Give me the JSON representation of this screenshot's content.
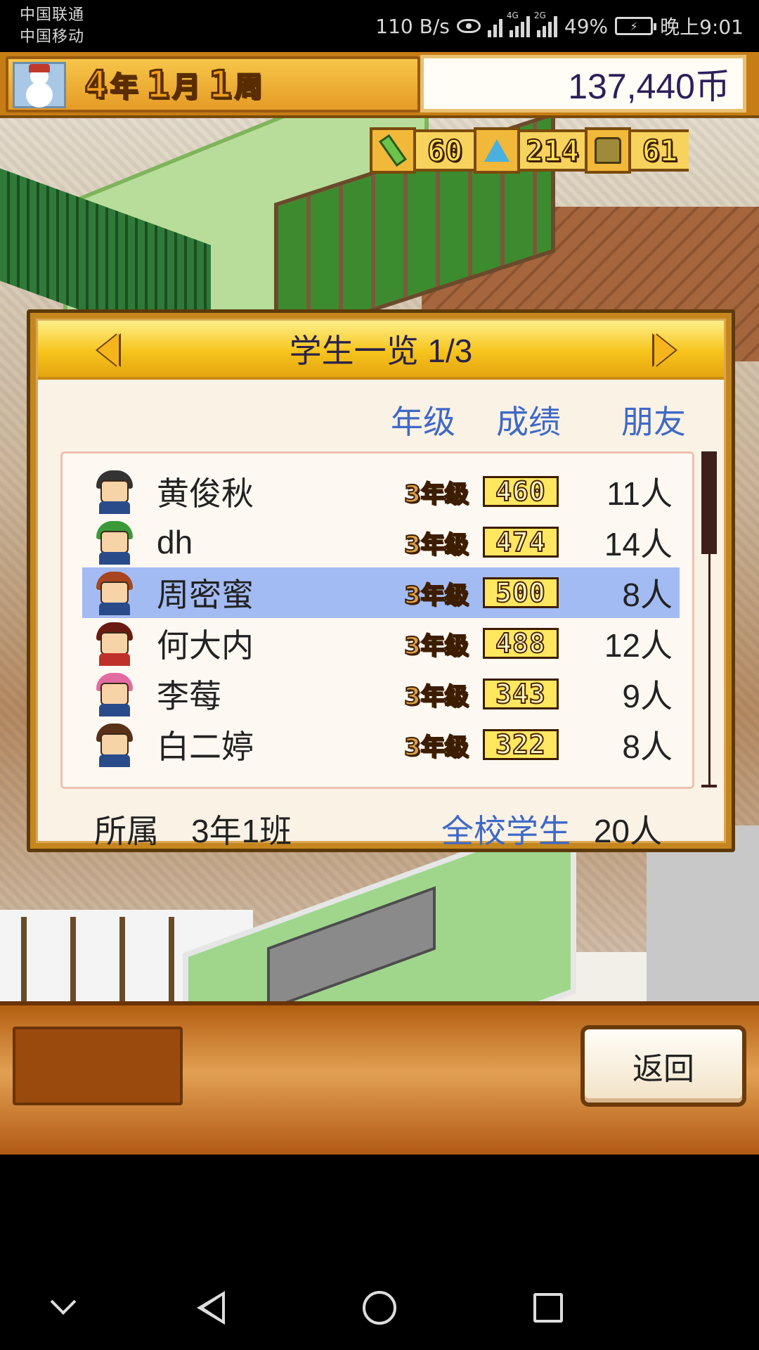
{
  "status_bar": {
    "carrier1": "中国联通",
    "carrier2": "中国移动",
    "net_speed": "110 B/s",
    "signal1_tag": "4G",
    "signal2_tag": "2G",
    "battery": "49%",
    "time": "晚上9:01"
  },
  "header": {
    "date": {
      "year": "4",
      "year_unit": "年",
      "month": "1",
      "month_unit": "月",
      "week": "1",
      "week_unit": "周"
    },
    "money": "137,440币"
  },
  "resources": [
    {
      "icon": "pencil-icon",
      "value": "60"
    },
    {
      "icon": "flask-icon",
      "value": "214"
    },
    {
      "icon": "bell-icon",
      "value": "61"
    }
  ],
  "dialog": {
    "title": "学生一览 1/3",
    "columns": {
      "grade": "年级",
      "score": "成绩",
      "friends": "朋友"
    },
    "students": [
      {
        "name": "黄俊秋",
        "grade": "3年级",
        "score": "460",
        "friends": "11人",
        "hair": "#333333",
        "body": "#2a4b8a"
      },
      {
        "name": "dh",
        "grade": "3年级",
        "score": "474",
        "friends": "14人",
        "hair": "#3a9a3a",
        "body": "#2a4b8a"
      },
      {
        "name": "周密蜜",
        "grade": "3年级",
        "score": "500",
        "friends": "8人",
        "hair": "#a8451e",
        "body": "#2a4b8a",
        "selected": true
      },
      {
        "name": "何大内",
        "grade": "3年级",
        "score": "488",
        "friends": "12人",
        "hair": "#6a1a12",
        "body": "#c0302a"
      },
      {
        "name": "李莓",
        "grade": "3年级",
        "score": "343",
        "friends": "9人",
        "hair": "#e26ca0",
        "body": "#2a4b8a"
      },
      {
        "name": "白二婷",
        "grade": "3年级",
        "score": "322",
        "friends": "8人",
        "hair": "#5a3018",
        "body": "#2a4b8a"
      }
    ],
    "footer": {
      "class_label": "所属",
      "class_value": "3年1班",
      "total_label": "全校学生",
      "total_value": "20人"
    }
  },
  "bottom": {
    "back_label": "返回"
  },
  "colors": {
    "accent_blue": "#3f69c6",
    "selected_row": "#a3bbf3",
    "title_gold": "#f6c41c"
  }
}
